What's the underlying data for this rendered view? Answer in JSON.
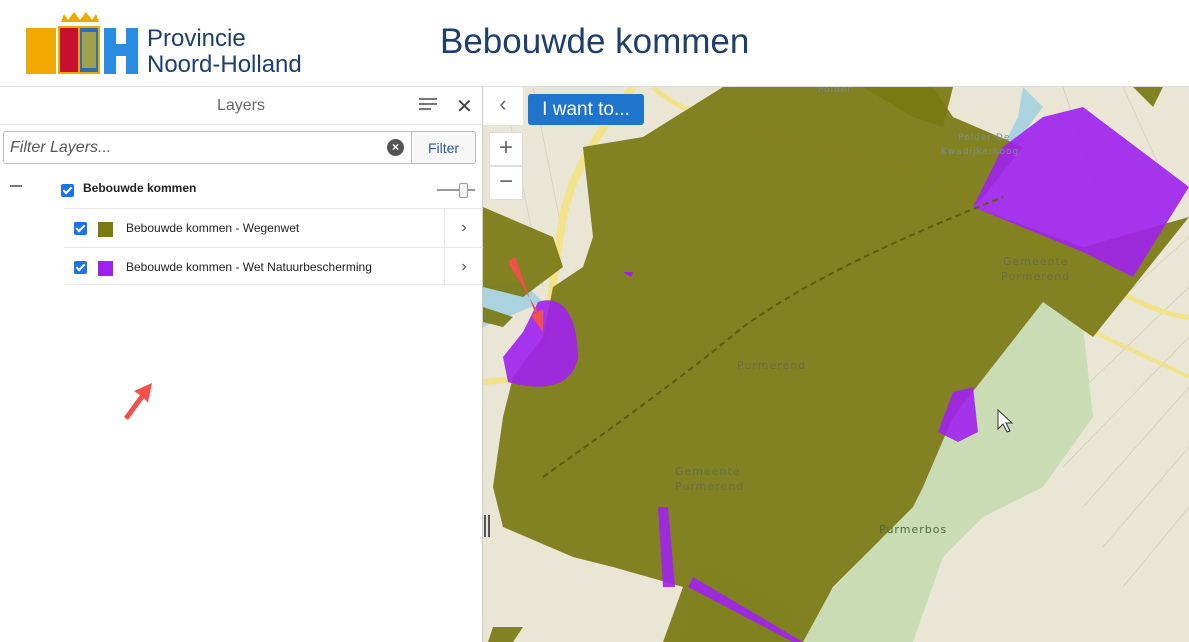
{
  "header": {
    "logo_line1": "Provincie",
    "logo_line2": "Noord-Holland",
    "app_title": "Bebouwde kommen"
  },
  "layers_panel": {
    "title": "Layers",
    "menu_icon": "list-icon",
    "close_icon": "close-icon",
    "filter": {
      "placeholder": "Filter Layers...",
      "value": "",
      "clear_icon": "clear-circle-icon",
      "button_label": "Filter"
    },
    "group": {
      "label": "Bebouwde kommen",
      "checked": true,
      "layers": [
        {
          "label": "Bebouwde kommen - Wegenwet",
          "color": "#7a7a12",
          "checked": true
        },
        {
          "label": "Bebouwde kommen - Wet Natuurbescherming",
          "color": "#a020f0",
          "checked": true
        }
      ]
    }
  },
  "map": {
    "collapse_icon": "chevron-left-icon",
    "i_want_to_label": "I want to...",
    "zoom_in_label": "+",
    "zoom_out_label": "−",
    "labels": {
      "purmerend": "Purmerend",
      "gemeente1a": "Gemeente",
      "gemeente1b": "Purmerend",
      "gemeente2a": "Gemeente",
      "gemeente2b": "Purmerend",
      "purmerbos": "Purmerbos",
      "poel": "Polder De",
      "kwadijk": "Kwadijkerkoog",
      "polder_top": "Polder"
    },
    "colors": {
      "wegenwet": "#7a7a12",
      "natuur": "#a020f0",
      "base": "#eae6d6",
      "forest": "#c9dcb4",
      "road": "#f2e28a"
    }
  }
}
